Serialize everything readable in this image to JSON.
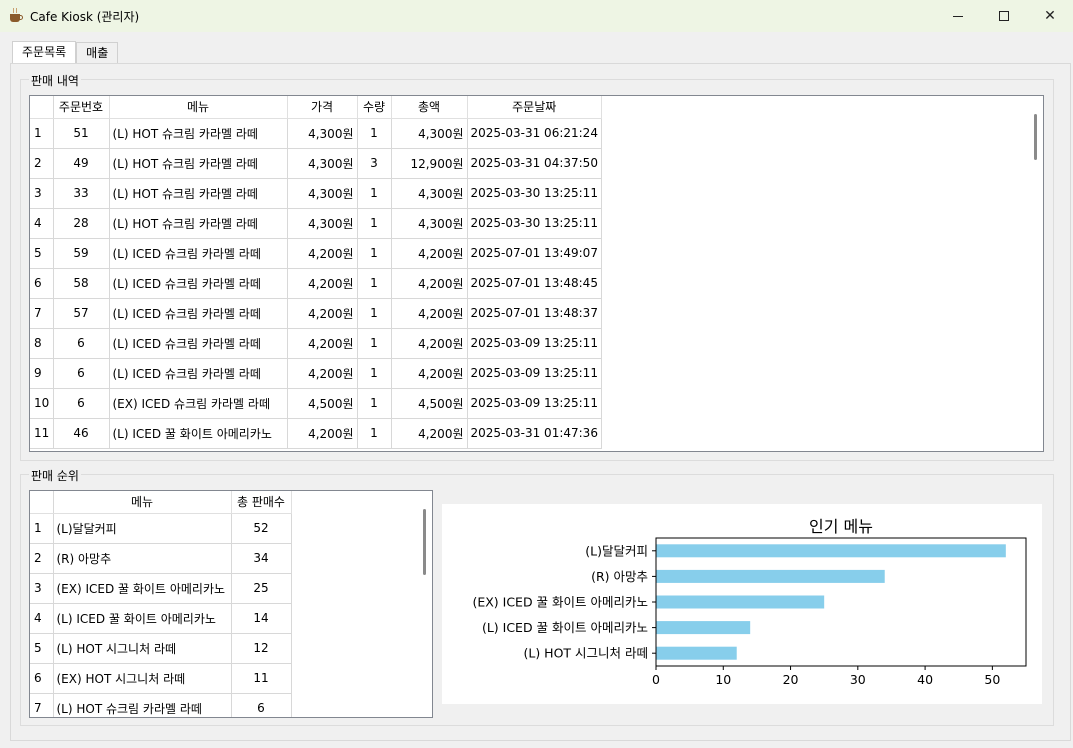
{
  "window": {
    "title": "Cafe Kiosk (관리자)",
    "minimize": "—",
    "maximize": "☐",
    "close": "✕"
  },
  "tabs": [
    {
      "label": "주문목록"
    },
    {
      "label": "매출"
    }
  ],
  "sales_history": {
    "title": "판매 내역",
    "columns": [
      "주문번호",
      "메뉴",
      "가격",
      "수량",
      "총액",
      "주문날짜"
    ],
    "rows": [
      [
        "1",
        "51",
        "(L) HOT 슈크림 카라멜 라떼",
        "4,300원",
        "1",
        "4,300원",
        "2025-03-31 06:21:24"
      ],
      [
        "2",
        "49",
        "(L) HOT 슈크림 카라멜 라떼",
        "4,300원",
        "3",
        "12,900원",
        "2025-03-31 04:37:50"
      ],
      [
        "3",
        "33",
        "(L) HOT 슈크림 카라멜 라떼",
        "4,300원",
        "1",
        "4,300원",
        "2025-03-30 13:25:11"
      ],
      [
        "4",
        "28",
        "(L) HOT 슈크림 카라멜 라떼",
        "4,300원",
        "1",
        "4,300원",
        "2025-03-30 13:25:11"
      ],
      [
        "5",
        "59",
        "(L) ICED 슈크림 카라멜 라떼",
        "4,200원",
        "1",
        "4,200원",
        "2025-07-01 13:49:07"
      ],
      [
        "6",
        "58",
        "(L) ICED 슈크림 카라멜 라떼",
        "4,200원",
        "1",
        "4,200원",
        "2025-07-01 13:48:45"
      ],
      [
        "7",
        "57",
        "(L) ICED 슈크림 카라멜 라떼",
        "4,200원",
        "1",
        "4,200원",
        "2025-07-01 13:48:37"
      ],
      [
        "8",
        "6",
        "(L) ICED 슈크림 카라멜 라떼",
        "4,200원",
        "1",
        "4,200원",
        "2025-03-09 13:25:11"
      ],
      [
        "9",
        "6",
        "(L) ICED 슈크림 카라멜 라떼",
        "4,200원",
        "1",
        "4,200원",
        "2025-03-09 13:25:11"
      ],
      [
        "10",
        "6",
        "(EX) ICED 슈크림 카라멜 라떼",
        "4,500원",
        "1",
        "4,500원",
        "2025-03-09 13:25:11"
      ],
      [
        "11",
        "46",
        "(L) ICED 꿀 화이트 아메리카노",
        "4,200원",
        "1",
        "4,200원",
        "2025-03-31 01:47:36"
      ]
    ]
  },
  "sales_ranking": {
    "title": "판매 순위",
    "columns": [
      "메뉴",
      "총 판매수"
    ],
    "rows": [
      [
        "1",
        "(L)달달커피",
        "52"
      ],
      [
        "2",
        "(R) 아망추",
        "34"
      ],
      [
        "3",
        "(EX) ICED 꿀 화이트 아메리카노",
        "25"
      ],
      [
        "4",
        "(L) ICED 꿀 화이트 아메리카노",
        "14"
      ],
      [
        "5",
        "(L) HOT 시그니처 라떼",
        "12"
      ],
      [
        "6",
        "(EX) HOT 시그니처 라떼",
        "11"
      ],
      [
        "7",
        "(L) HOT 슈크림 카라멜 라떼",
        "6"
      ]
    ]
  },
  "chart_data": {
    "type": "bar",
    "orientation": "horizontal",
    "title": "인기 메뉴",
    "categories": [
      "(L)달달커피",
      "(R) 아망추",
      "(EX) ICED 꿀 화이트 아메리카노",
      "(L) ICED 꿀 화이트 아메리카노",
      "(L) HOT 시그니처 라떼"
    ],
    "values": [
      52,
      34,
      25,
      14,
      12
    ],
    "xlim": [
      0,
      55
    ],
    "xticks": [
      0,
      10,
      20,
      30,
      40,
      50
    ],
    "bar_color": "#87ceeb",
    "grid": false,
    "legend": false
  }
}
